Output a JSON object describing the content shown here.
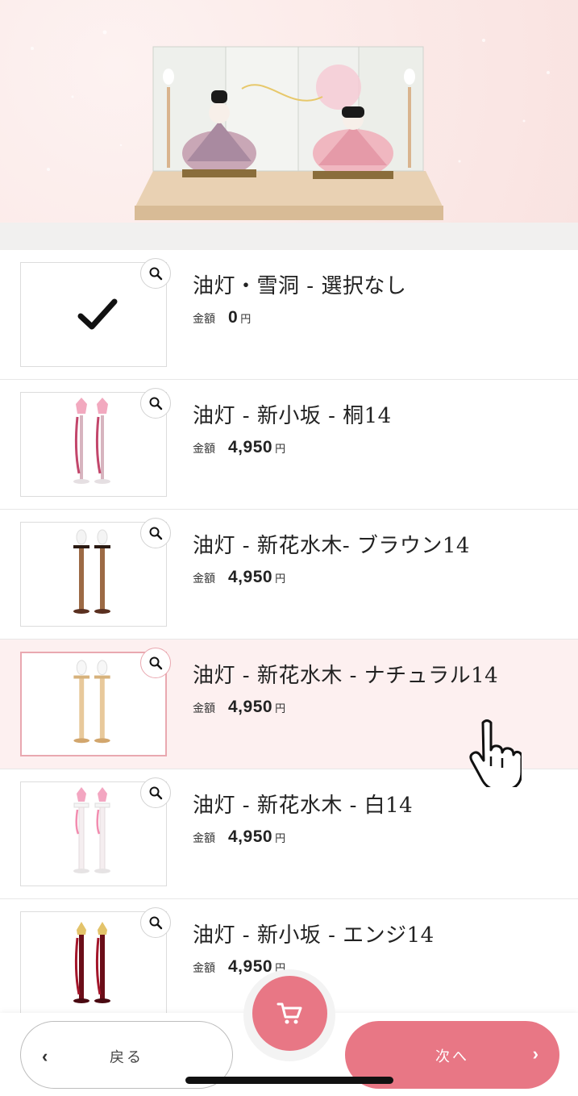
{
  "hero": {
    "image": "hina-doll-display-with-folding-screen",
    "alt_icon": "hina-dolls-image"
  },
  "options": [
    {
      "title": "油灯・雪洞 - 選択なし",
      "price_label": "金額",
      "price": "0",
      "unit": "円",
      "image": "none-check",
      "selected": false
    },
    {
      "title": "油灯 - 新小坂 - 桐14",
      "price_label": "金額",
      "price": "4,950",
      "unit": "円",
      "image": "pink-candle-stands",
      "selected": false
    },
    {
      "title": "油灯 - 新花水木- ブラウン14",
      "price_label": "金額",
      "price": "4,950",
      "unit": "円",
      "image": "brown-candle-stands",
      "selected": false
    },
    {
      "title": "油灯 - 新花水木 - ナチュラル14",
      "price_label": "金額",
      "price": "4,950",
      "unit": "円",
      "image": "natural-candle-stands",
      "selected": true
    },
    {
      "title": "油灯 - 新花水木 - 白14",
      "price_label": "金額",
      "price": "4,950",
      "unit": "円",
      "image": "white-candle-stands",
      "selected": false
    },
    {
      "title": "油灯 - 新小坂 - エンジ14",
      "price_label": "金額",
      "price": "4,950",
      "unit": "円",
      "image": "crimson-candle-stands",
      "selected": false
    }
  ],
  "footer": {
    "back_label": "戻る",
    "next_label": "次へ",
    "cart_icon": "cart-icon"
  },
  "colors": {
    "accent": "#e87785",
    "selected_bg": "#fdf0f0",
    "hero_bg": "#fbe9e7"
  }
}
